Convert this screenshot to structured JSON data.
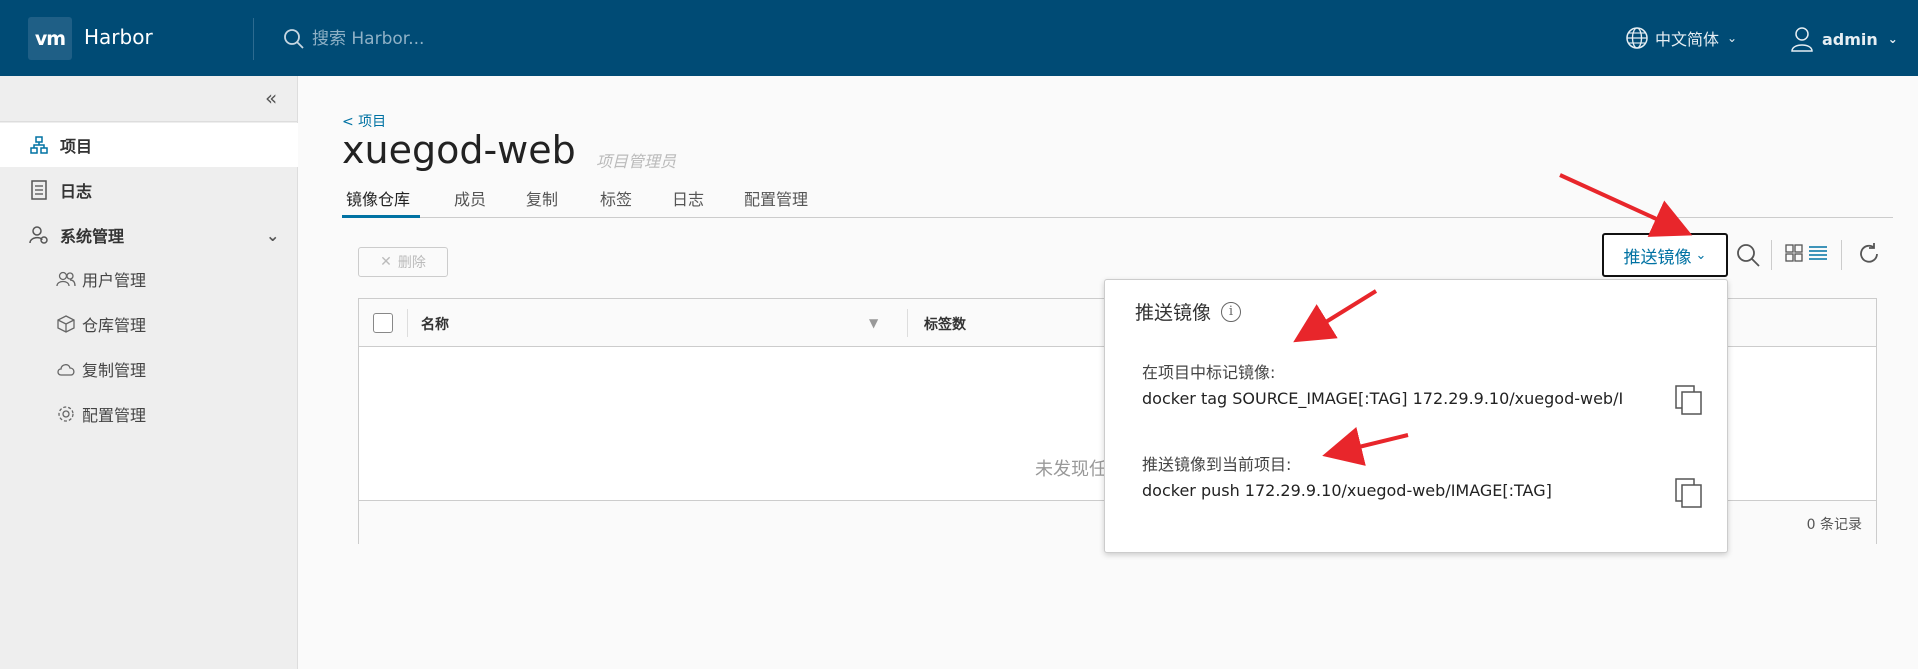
{
  "header": {
    "logo": "vm",
    "app_name": "Harbor",
    "search_placeholder": "搜索 Harbor...",
    "language": "中文简体",
    "user": "admin"
  },
  "sidebar": {
    "items": [
      {
        "label": "项目",
        "icon": "projects-icon",
        "active": true
      },
      {
        "label": "日志",
        "icon": "logs-icon"
      },
      {
        "label": "系统管理",
        "icon": "admin-icon"
      }
    ],
    "sub_items": [
      {
        "label": "用户管理",
        "icon": "users-icon"
      },
      {
        "label": "仓库管理",
        "icon": "registry-icon"
      },
      {
        "label": "复制管理",
        "icon": "replication-icon"
      },
      {
        "label": "配置管理",
        "icon": "config-icon"
      }
    ]
  },
  "main": {
    "back_link": "< 项目",
    "title": "xuegod-web",
    "role": "项目管理员",
    "tabs": [
      "镜像仓库",
      "成员",
      "复制",
      "标签",
      "日志",
      "配置管理"
    ],
    "delete_label": "删除",
    "push_button": "推送镜像",
    "table": {
      "columns": [
        "名称",
        "标签数"
      ],
      "empty_text": "未发现任",
      "records": "0 条记录"
    }
  },
  "popover": {
    "title": "推送镜像",
    "tag_label": "在项目中标记镜像:",
    "tag_cmd": "docker tag SOURCE_IMAGE[:TAG] 172.29.9.10/xuegod-web/I",
    "push_label": "推送镜像到当前项目:",
    "push_cmd": "docker push 172.29.9.10/xuegod-web/IMAGE[:TAG]"
  },
  "colors": {
    "header_bg": "#004b75",
    "accent": "#0072a3",
    "annotation": "#e8262b"
  }
}
